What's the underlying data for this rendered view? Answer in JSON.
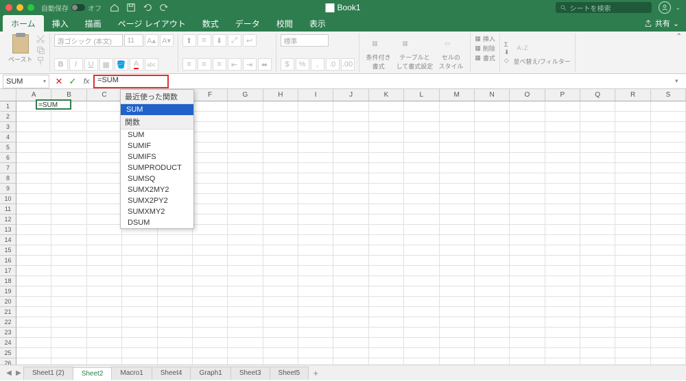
{
  "titlebar": {
    "autosave_label": "自動保存",
    "autosave_state": "オフ",
    "title": "Book1",
    "search_placeholder": "シートを検索"
  },
  "menu": {
    "tabs": [
      "ホーム",
      "挿入",
      "描画",
      "ページ レイアウト",
      "数式",
      "データ",
      "校閲",
      "表示"
    ],
    "share": "共有"
  },
  "ribbon": {
    "paste": "ペースト",
    "font_name": "游ゴシック (本文)",
    "font_size": "11",
    "number_format": "標準",
    "cond_fmt": "条件付き\n書式",
    "table_fmt": "テーブルと\nして書式設定",
    "cell_style": "セルの\nスタイル",
    "insert": "挿入",
    "delete": "削除",
    "format": "書式",
    "sort_filter": "並べ替え/フィルター"
  },
  "formula_bar": {
    "name_box": "SUM",
    "formula": "=SUM"
  },
  "grid": {
    "columns": [
      "A",
      "B",
      "C",
      "D",
      "E",
      "F",
      "G",
      "H",
      "I",
      "J",
      "K",
      "L",
      "M",
      "N",
      "O",
      "P",
      "Q",
      "R",
      "S"
    ],
    "rows": 27,
    "active_cell_value": "=SUM"
  },
  "suggest": {
    "recent_header": "最近使った関数",
    "recent_item": "SUM",
    "func_header": "関数",
    "items": [
      "SUM",
      "SUMIF",
      "SUMIFS",
      "SUMPRODUCT",
      "SUMSQ",
      "SUMX2MY2",
      "SUMX2PY2",
      "SUMXMY2",
      "DSUM"
    ]
  },
  "sheets": {
    "tabs": [
      "Sheet1 (2)",
      "Sheet2",
      "Macro1",
      "Sheet4",
      "Graph1",
      "Sheet3",
      "Sheet5"
    ],
    "active": 1
  }
}
